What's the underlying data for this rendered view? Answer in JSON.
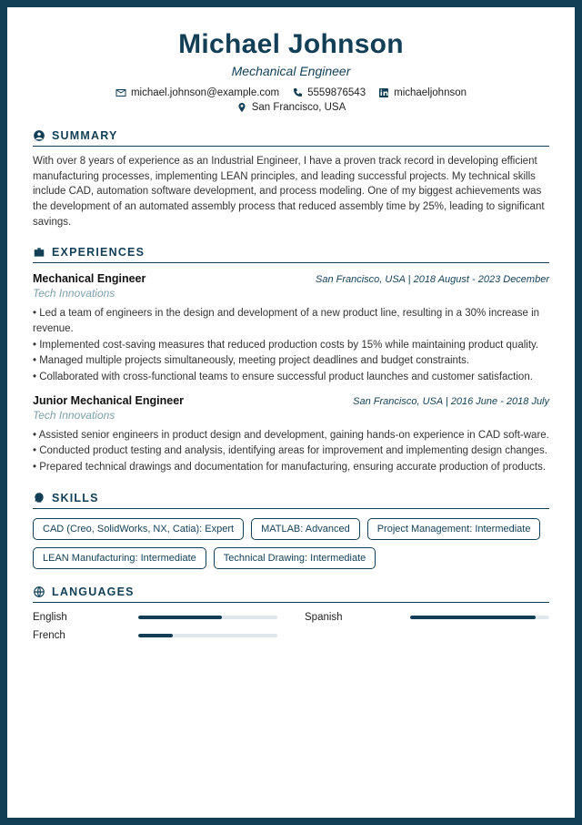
{
  "header": {
    "name": "Michael Johnson",
    "role": "Mechanical Engineer",
    "email": "michael.johnson@example.com",
    "phone": "5559876543",
    "linkedin": "michaeljohnson",
    "location": "San Francisco, USA"
  },
  "sections": {
    "summary": "SUMMARY",
    "experiences": "EXPERIENCES",
    "skills": "SKILLS",
    "languages": "LANGUAGES"
  },
  "summary": "With over 8 years of experience as an Industrial Engineer, I have a proven track record in developing efficient manufacturing processes, implementing LEAN principles, and leading successful projects. My technical skills include CAD, automation software development, and process modeling. One of my biggest achievements was the development of an automated assembly process that reduced assembly time by 25%, leading to significant savings.",
  "jobs": [
    {
      "title": "Mechanical Engineer",
      "company": "Tech Innovations",
      "meta": "San Francisco, USA  |  2018 August - 2023 December",
      "bullets": [
        "• Led a team of engineers in the design and development of a new product line, resulting in a 30% increase in revenue.",
        "• Implemented cost-saving measures that reduced production costs by 15% while maintaining product quality.",
        "• Managed multiple projects simultaneously, meeting project deadlines and budget constraints.",
        "• Collaborated with cross-functional teams to ensure successful product launches and customer satisfaction."
      ]
    },
    {
      "title": "Junior Mechanical Engineer",
      "company": "Tech Innovations",
      "meta": "San Francisco, USA  |  2016 June - 2018 July",
      "bullets": [
        "• Assisted senior engineers in product design and development, gaining hands-on experience in CAD soft-ware.",
        "• Conducted product testing and analysis, identifying areas for improvement and implementing design changes.",
        "• Prepared technical drawings and documentation for manufacturing, ensuring accurate production of products."
      ]
    }
  ],
  "skills": [
    "CAD (Creo, SolidWorks, NX, Catia): Expert",
    "MATLAB: Advanced",
    "Project Management: Intermediate",
    "LEAN Manufacturing: Intermediate",
    "Technical Drawing: Intermediate"
  ],
  "languages": [
    {
      "name": "English",
      "level": 60
    },
    {
      "name": "Spanish",
      "level": 90
    },
    {
      "name": "French",
      "level": 25
    }
  ]
}
